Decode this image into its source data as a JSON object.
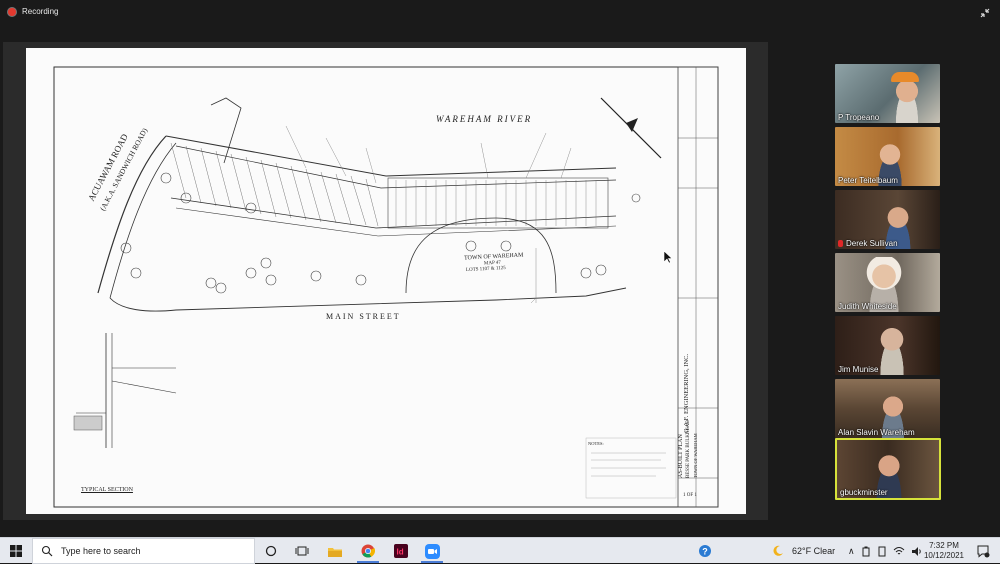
{
  "recording": {
    "label": "Recording"
  },
  "drawing": {
    "road_left": "ACUAWAM ROAD",
    "road_left_aka": "(A.K.A. SANDWICH ROAD)",
    "river": "WAREHAM RIVER",
    "street": "MAIN STREET",
    "town_line1": "TOWN OF WAREHAM",
    "town_line2": "MAP 47",
    "town_line3": "LOTS 1107 & 1125",
    "section_title": "TYPICAL SECTION",
    "notes_title": "NOTES:",
    "engineer": "G.A.F. ENGINEERING, INC.",
    "plan_title": "AS-BUILT PLAN",
    "plan_sub1": "BESSE PARK BULKHEAD",
    "plan_sub2": "TOWN OF WAREHAM",
    "sheet_no": "1 OF 1"
  },
  "participants": [
    {
      "name": "P Tropeano",
      "muted": false,
      "active": false,
      "bg": "#6d7f86"
    },
    {
      "name": "Peter Teitelbaum",
      "muted": false,
      "active": false,
      "bg": "#b77a36"
    },
    {
      "name": "Derek Sullivan",
      "muted": true,
      "active": false,
      "bg": "#4a3b30"
    },
    {
      "name": "Judith Whiteside",
      "muted": false,
      "active": false,
      "bg": "#8a8175"
    },
    {
      "name": "Jim Munise",
      "muted": false,
      "active": false,
      "bg": "#3b2a22"
    },
    {
      "name": "Alan Slavin Wareham",
      "muted": false,
      "active": false,
      "bg": "#5f4a36"
    },
    {
      "name": "gbuckminster",
      "muted": false,
      "active": true,
      "bg": "#4b3a2c"
    }
  ],
  "taskbar": {
    "search_placeholder": "Type here to search",
    "weather": "62°F  Clear",
    "time": "7:32 PM",
    "date": "10/12/2021"
  }
}
